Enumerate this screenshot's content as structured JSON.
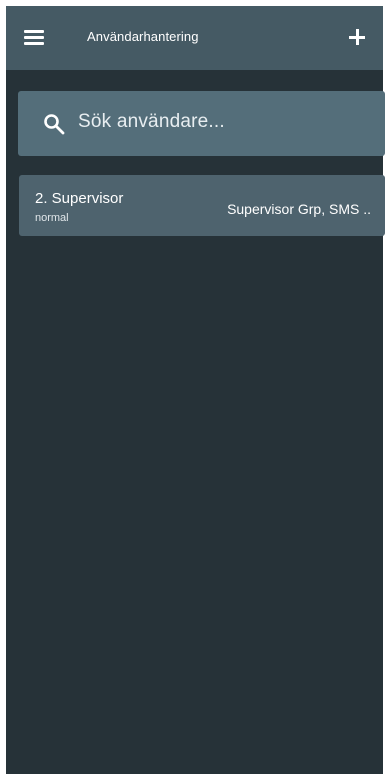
{
  "appbar": {
    "title": "Användarhantering",
    "menu_icon": "hamburger-menu-icon",
    "add_icon": "plus-icon"
  },
  "search": {
    "placeholder": "Sök användare...",
    "icon": "search-icon"
  },
  "users": [
    {
      "name": "2. Supervisor",
      "type": "normal",
      "groups": "Supervisor Grp, SMS .."
    }
  ],
  "colors": {
    "appbar": "#455a64",
    "background": "#263238",
    "search_field": "#546e7a",
    "list_item": "#4e636e"
  }
}
